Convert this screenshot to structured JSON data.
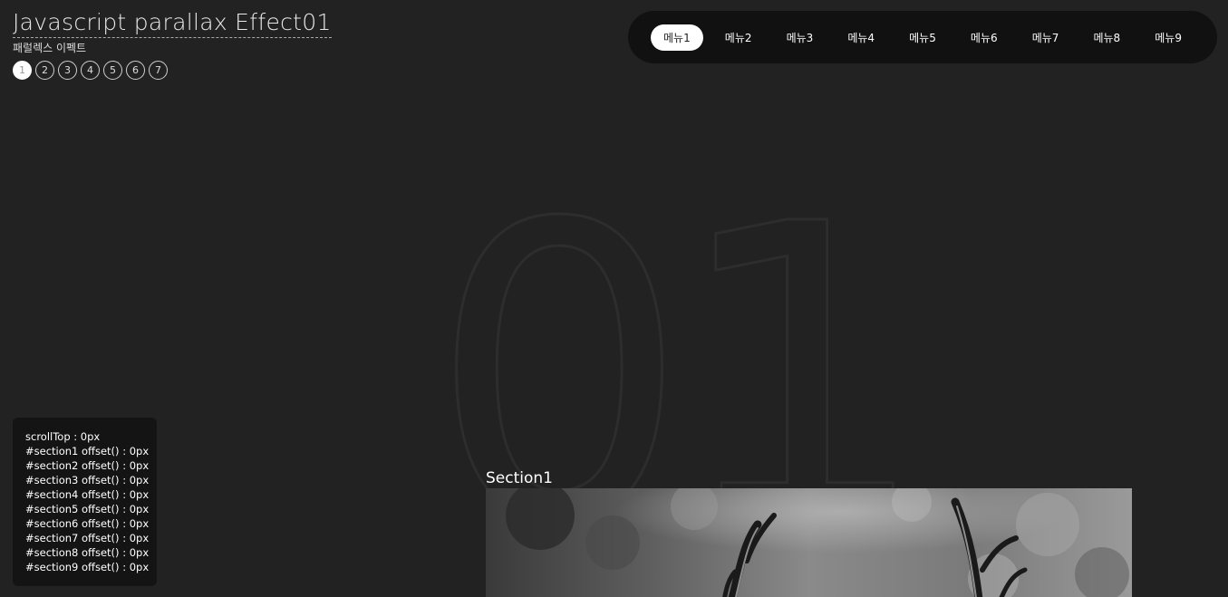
{
  "header": {
    "title": "Javascript parallax Effect01",
    "subtitle": "패럴렉스 이펙트",
    "pager": [
      "1",
      "2",
      "3",
      "4",
      "5",
      "6",
      "7"
    ],
    "pager_active_index": 0
  },
  "nav": {
    "items": [
      "메뉴1",
      "메뉴2",
      "메뉴3",
      "메뉴4",
      "메뉴5",
      "메뉴6",
      "메뉴7",
      "메뉴8",
      "메뉴9"
    ],
    "active_index": 0
  },
  "section": {
    "big_number": "01",
    "label": "Section1",
    "image": "grayscale-deer-antlers-photo"
  },
  "info": {
    "lines": [
      "scrollTop : 0px",
      "#section1 offset() : 0px",
      "#section2 offset() : 0px",
      "#section3 offset() : 0px",
      "#section4 offset() : 0px",
      "#section5 offset() : 0px",
      "#section6 offset() : 0px",
      "#section7 offset() : 0px",
      "#section8 offset() : 0px",
      "#section9 offset() : 0px"
    ]
  },
  "colors": {
    "background": "#222222",
    "nav_background": "#111111",
    "info_background": "#141414",
    "active": "#ffffff"
  }
}
